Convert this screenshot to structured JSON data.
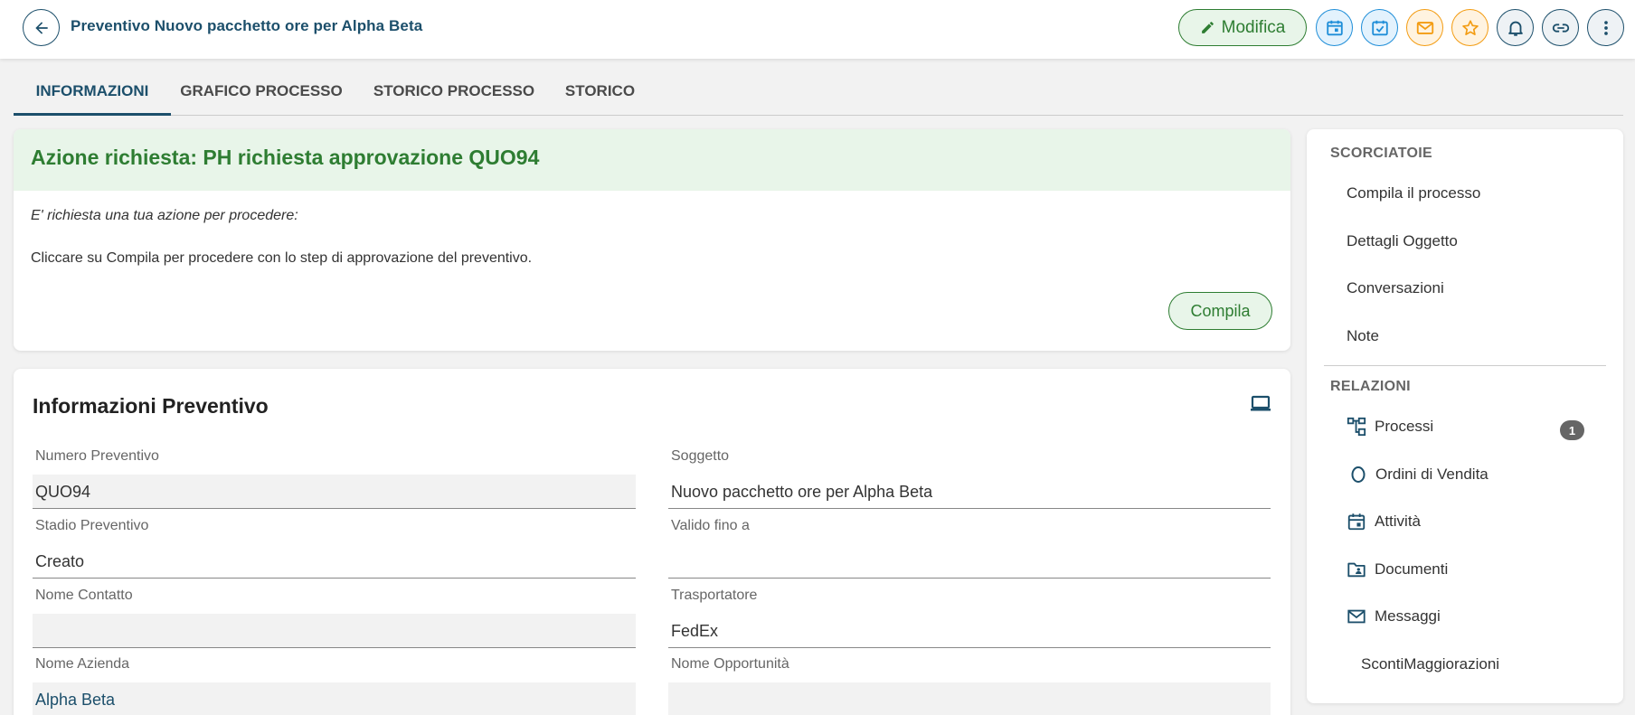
{
  "header": {
    "title": "Preventivo Nuovo pacchetto ore per Alpha Beta",
    "edit_label": "Modifica",
    "icons": [
      "arrow-left-icon",
      "pencil-icon",
      "calendar-icon",
      "check-calendar-icon",
      "mail-icon",
      "star-icon",
      "bell-icon",
      "link-icon",
      "more-vert-icon"
    ]
  },
  "tabs": [
    "INFORMAZIONI",
    "GRAFICO PROCESSO",
    "STORICO PROCESSO",
    "STORICO"
  ],
  "action": {
    "title": "Azione richiesta: PH richiesta approvazione QUO94",
    "subtitle": "E' richiesta una tua azione per procedere:",
    "text": "Cliccare su Compila per procedere con lo step di approvazione del preventivo.",
    "button": "Compila"
  },
  "info": {
    "title": "Informazioni Preventivo",
    "fields": [
      {
        "label": "Numero Preventivo",
        "value": "QUO94"
      },
      {
        "label": "Soggetto",
        "value": "Nuovo pacchetto ore per Alpha Beta"
      },
      {
        "label": "Stadio Preventivo",
        "value": "Creato"
      },
      {
        "label": "Valido fino a",
        "value": ""
      },
      {
        "label": "Nome Contatto",
        "value": ""
      },
      {
        "label": "Trasportatore",
        "value": "FedEx"
      },
      {
        "label": "Nome Azienda",
        "value": "Alpha Beta"
      },
      {
        "label": "Nome Opportunità",
        "value": ""
      }
    ]
  },
  "sidebar": {
    "shortcuts_title": "SCORCIATOIE",
    "shortcuts": [
      "Compila il processo",
      "Dettagli Oggetto",
      "Conversazioni",
      "Note"
    ],
    "relations_title": "RELAZIONI",
    "relations": [
      {
        "label": "Processi",
        "icon": "process-tree-icon",
        "badge": "1"
      },
      {
        "label": "Ordini di Vendita",
        "icon": "circle-icon"
      },
      {
        "label": "Attività",
        "icon": "calendar-icon"
      },
      {
        "label": "Documenti",
        "icon": "folder-user-icon"
      },
      {
        "label": "Messaggi",
        "icon": "mail-icon"
      },
      {
        "label": "ScontiMaggiorazioni",
        "icon": ""
      }
    ]
  },
  "colors": {
    "primary": "#1c4f6b",
    "success": "#2e7d32",
    "success_bg": "#e8f5e9",
    "info": "#1f8ed8",
    "warning": "#f39c12"
  }
}
